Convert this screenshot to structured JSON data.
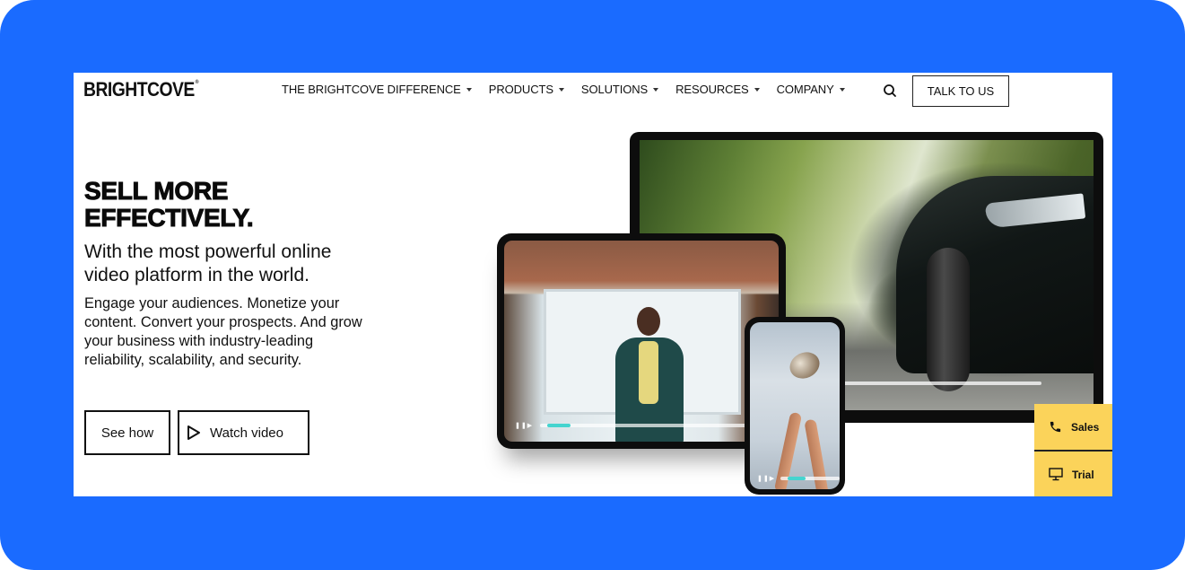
{
  "brand": {
    "logo_text": "BRIGHTCOVE",
    "logo_mark": "®",
    "frame_color": "#1a6bff",
    "accent_yellow": "#fbd35a",
    "progress_accent": "#45d4cf"
  },
  "header": {
    "nav": [
      {
        "label": "THE BRIGHTCOVE DIFFERENCE",
        "icon": "caret-down-icon"
      },
      {
        "label": "PRODUCTS",
        "icon": "caret-down-icon"
      },
      {
        "label": "SOLUTIONS",
        "icon": "caret-down-icon"
      },
      {
        "label": "RESOURCES",
        "icon": "caret-down-icon"
      },
      {
        "label": "COMPANY",
        "icon": "caret-down-icon"
      }
    ],
    "search_icon": "search-icon",
    "cta_label": "TALK TO US"
  },
  "hero": {
    "headline_line1": "SELL MORE",
    "headline_line2": "EFFECTIVELY.",
    "subhead": "With the most powerful online video platform in the world.",
    "body": "Engage your audiences. Monetize your content. Convert your prospects. And grow your business with industry-leading reliability, scalability, and security.",
    "buttons": {
      "see_how": "See how",
      "watch_video": "Watch video",
      "watch_icon": "play-icon"
    }
  },
  "illustration": {
    "devices": [
      "monitor",
      "tablet",
      "phone"
    ],
    "tablet_progress": 0.1,
    "phone_progress": 0.3
  },
  "sticky_contact": {
    "items": [
      {
        "label": "Sales",
        "icon": "phone-icon"
      },
      {
        "label": "Trial",
        "icon": "monitor-icon"
      }
    ]
  }
}
